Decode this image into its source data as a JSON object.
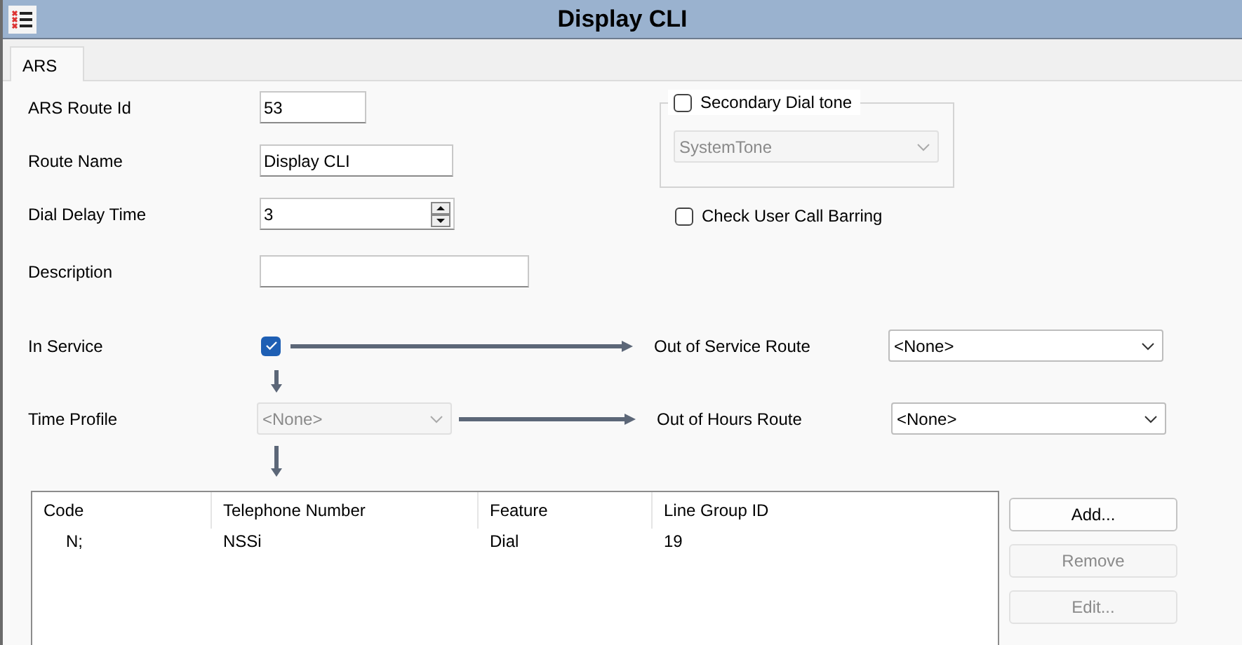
{
  "window": {
    "title": "Display CLI"
  },
  "tabs": [
    {
      "label": "ARS",
      "selected": true
    }
  ],
  "fields": [
    {
      "label": "ARS Route Id",
      "value": "53",
      "kind": "text"
    },
    {
      "label": "Route Name",
      "value": "Display CLI",
      "kind": "text"
    },
    {
      "label": "Dial Delay Time",
      "value": "3",
      "kind": "spin"
    },
    {
      "label": "Description",
      "kind": "text"
    }
  ],
  "secondary_dial_tone": {
    "label": "Secondary Dial tone",
    "checked": false,
    "select": {
      "value": "SystemTone",
      "disabled": true
    }
  },
  "check_user_call_barring": {
    "label": "Check User Call Barring",
    "checked": false
  },
  "in_service": {
    "label": "In Service",
    "checked": true,
    "route_label": "Out of Service Route",
    "route_value": "<None>"
  },
  "time_profile": {
    "label": "Time Profile",
    "value": "<None>",
    "disabled": true,
    "route_label": "Out of Hours Route",
    "route_value": "<None>"
  },
  "table": {
    "columns": [
      "Code",
      "Telephone Number",
      "Feature",
      "Line Group ID"
    ],
    "rows": [
      [
        "N;",
        "NSSi",
        "Dial",
        "19"
      ]
    ]
  },
  "buttons": [
    {
      "label": "Add...",
      "disabled": false
    },
    {
      "label": "Remove",
      "disabled": true
    },
    {
      "label": "Edit...",
      "disabled": true
    }
  ]
}
